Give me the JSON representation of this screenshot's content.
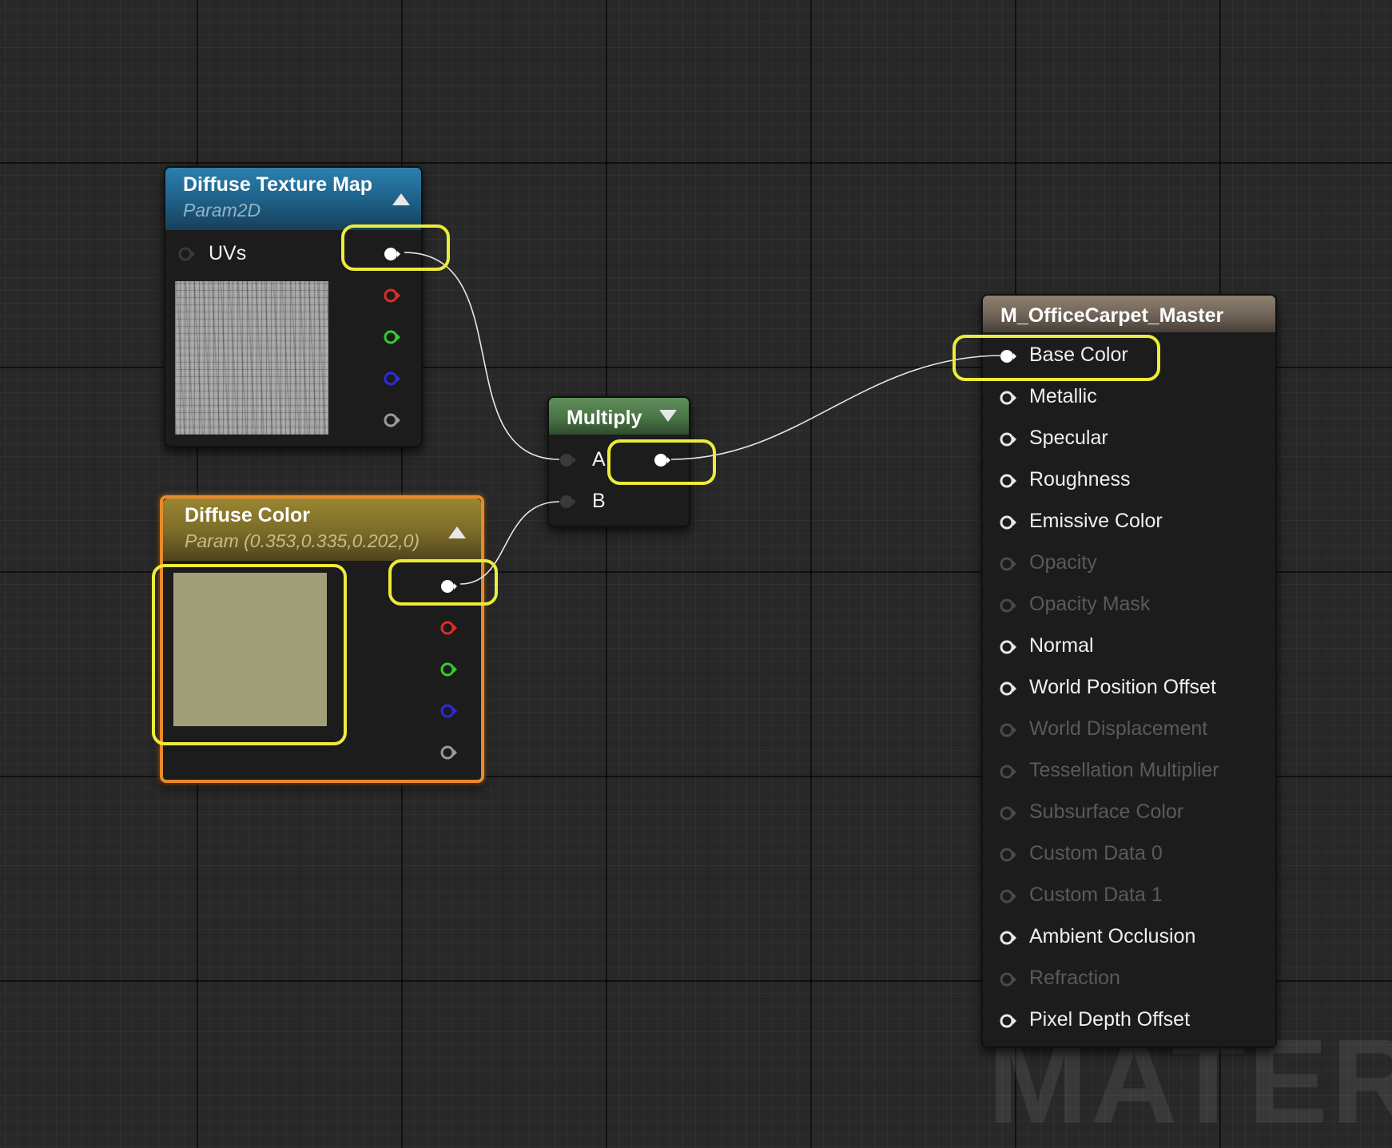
{
  "nodes": {
    "texture": {
      "title": "Diffuse Texture Map",
      "subtitle": "Param2D",
      "input_label": "UVs",
      "header_color": "#1e6f99"
    },
    "color": {
      "title": "Diffuse Color",
      "subtitle": "Param (0.353,0.335,0.202,0)",
      "swatch_color": "#a09f79",
      "header_color": "#8a7a2f"
    },
    "multiply": {
      "title": "Multiply",
      "input_a": "A",
      "input_b": "B",
      "header_color": "#4f7a4c"
    },
    "material": {
      "title": "M_OfficeCarpet_Master",
      "header_color": "#6e6356",
      "inputs": [
        {
          "label": "Base Color",
          "enabled": true
        },
        {
          "label": "Metallic",
          "enabled": true
        },
        {
          "label": "Specular",
          "enabled": true
        },
        {
          "label": "Roughness",
          "enabled": true
        },
        {
          "label": "Emissive Color",
          "enabled": true
        },
        {
          "label": "Opacity",
          "enabled": false
        },
        {
          "label": "Opacity Mask",
          "enabled": false
        },
        {
          "label": "Normal",
          "enabled": true
        },
        {
          "label": "World Position Offset",
          "enabled": true
        },
        {
          "label": "World Displacement",
          "enabled": false
        },
        {
          "label": "Tessellation Multiplier",
          "enabled": false
        },
        {
          "label": "Subsurface Color",
          "enabled": false
        },
        {
          "label": "Custom Data 0",
          "enabled": false
        },
        {
          "label": "Custom Data 1",
          "enabled": false
        },
        {
          "label": "Ambient Occlusion",
          "enabled": true
        },
        {
          "label": "Refraction",
          "enabled": false
        },
        {
          "label": "Pixel Depth Offset",
          "enabled": true
        }
      ]
    }
  },
  "watermark": "MATERIAL",
  "colors": {
    "highlight": "#ecec3a",
    "selected_border": "#e98a2a",
    "pin_red": "#e02a2a",
    "pin_green": "#2fcf2f",
    "pin_blue": "#2a2ae0",
    "pin_alpha": "#9a9a9a"
  }
}
